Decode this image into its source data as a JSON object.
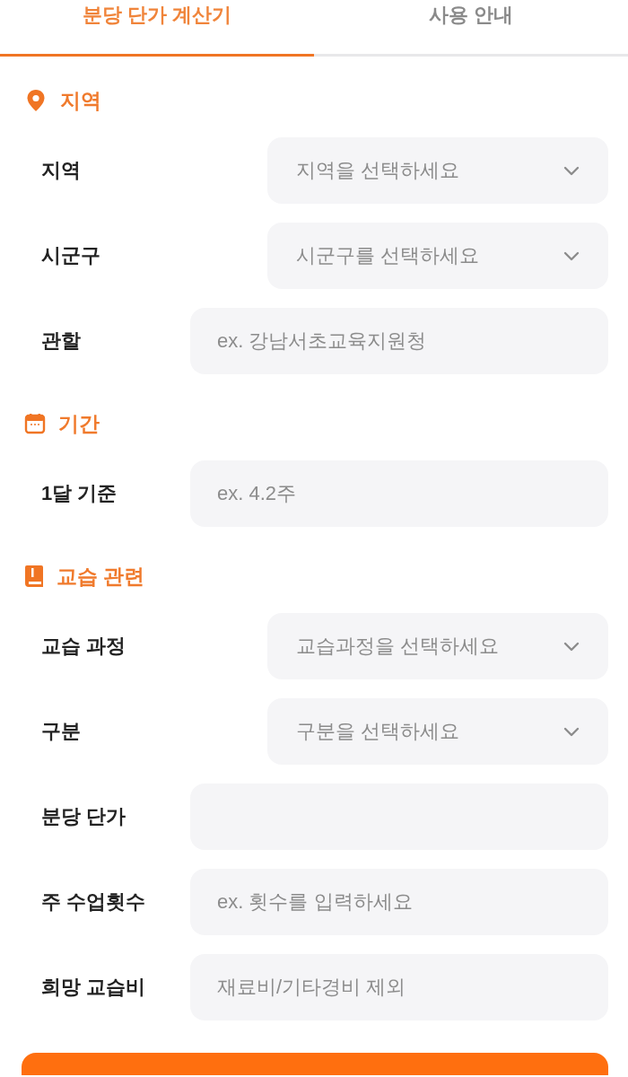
{
  "tabs": [
    {
      "label": "분당 단가 계산기",
      "selected": true
    },
    {
      "label": "사용 안내",
      "selected": false
    }
  ],
  "sections": [
    {
      "title": "지역",
      "fields": [
        {
          "label": "지역",
          "kind": "select",
          "placeholder": "지역을 선택하세요"
        },
        {
          "label": "시군구",
          "kind": "select",
          "placeholder": "시군구를 선택하세요"
        },
        {
          "label": "관할",
          "kind": "input",
          "placeholder": "ex. 강남서초교육지원청"
        }
      ]
    },
    {
      "title": "기간",
      "fields": [
        {
          "label": "1달 기준",
          "kind": "input",
          "placeholder": "ex. 4.2주"
        }
      ]
    },
    {
      "title": "교습 관련",
      "fields": [
        {
          "label": "교습 과정",
          "kind": "select",
          "placeholder": "교습과정을 선택하세요"
        },
        {
          "label": "구분",
          "kind": "select",
          "placeholder": "구분을 선택하세요"
        },
        {
          "label": "분당 단가",
          "kind": "input"
        },
        {
          "label": "주 수업횟수",
          "kind": "input",
          "placeholder": "ex. 횟수를 입력하세요"
        },
        {
          "label": "희망 교습비",
          "kind": "input",
          "placeholder": "재료비/기타경비 제외"
        }
      ]
    }
  ]
}
